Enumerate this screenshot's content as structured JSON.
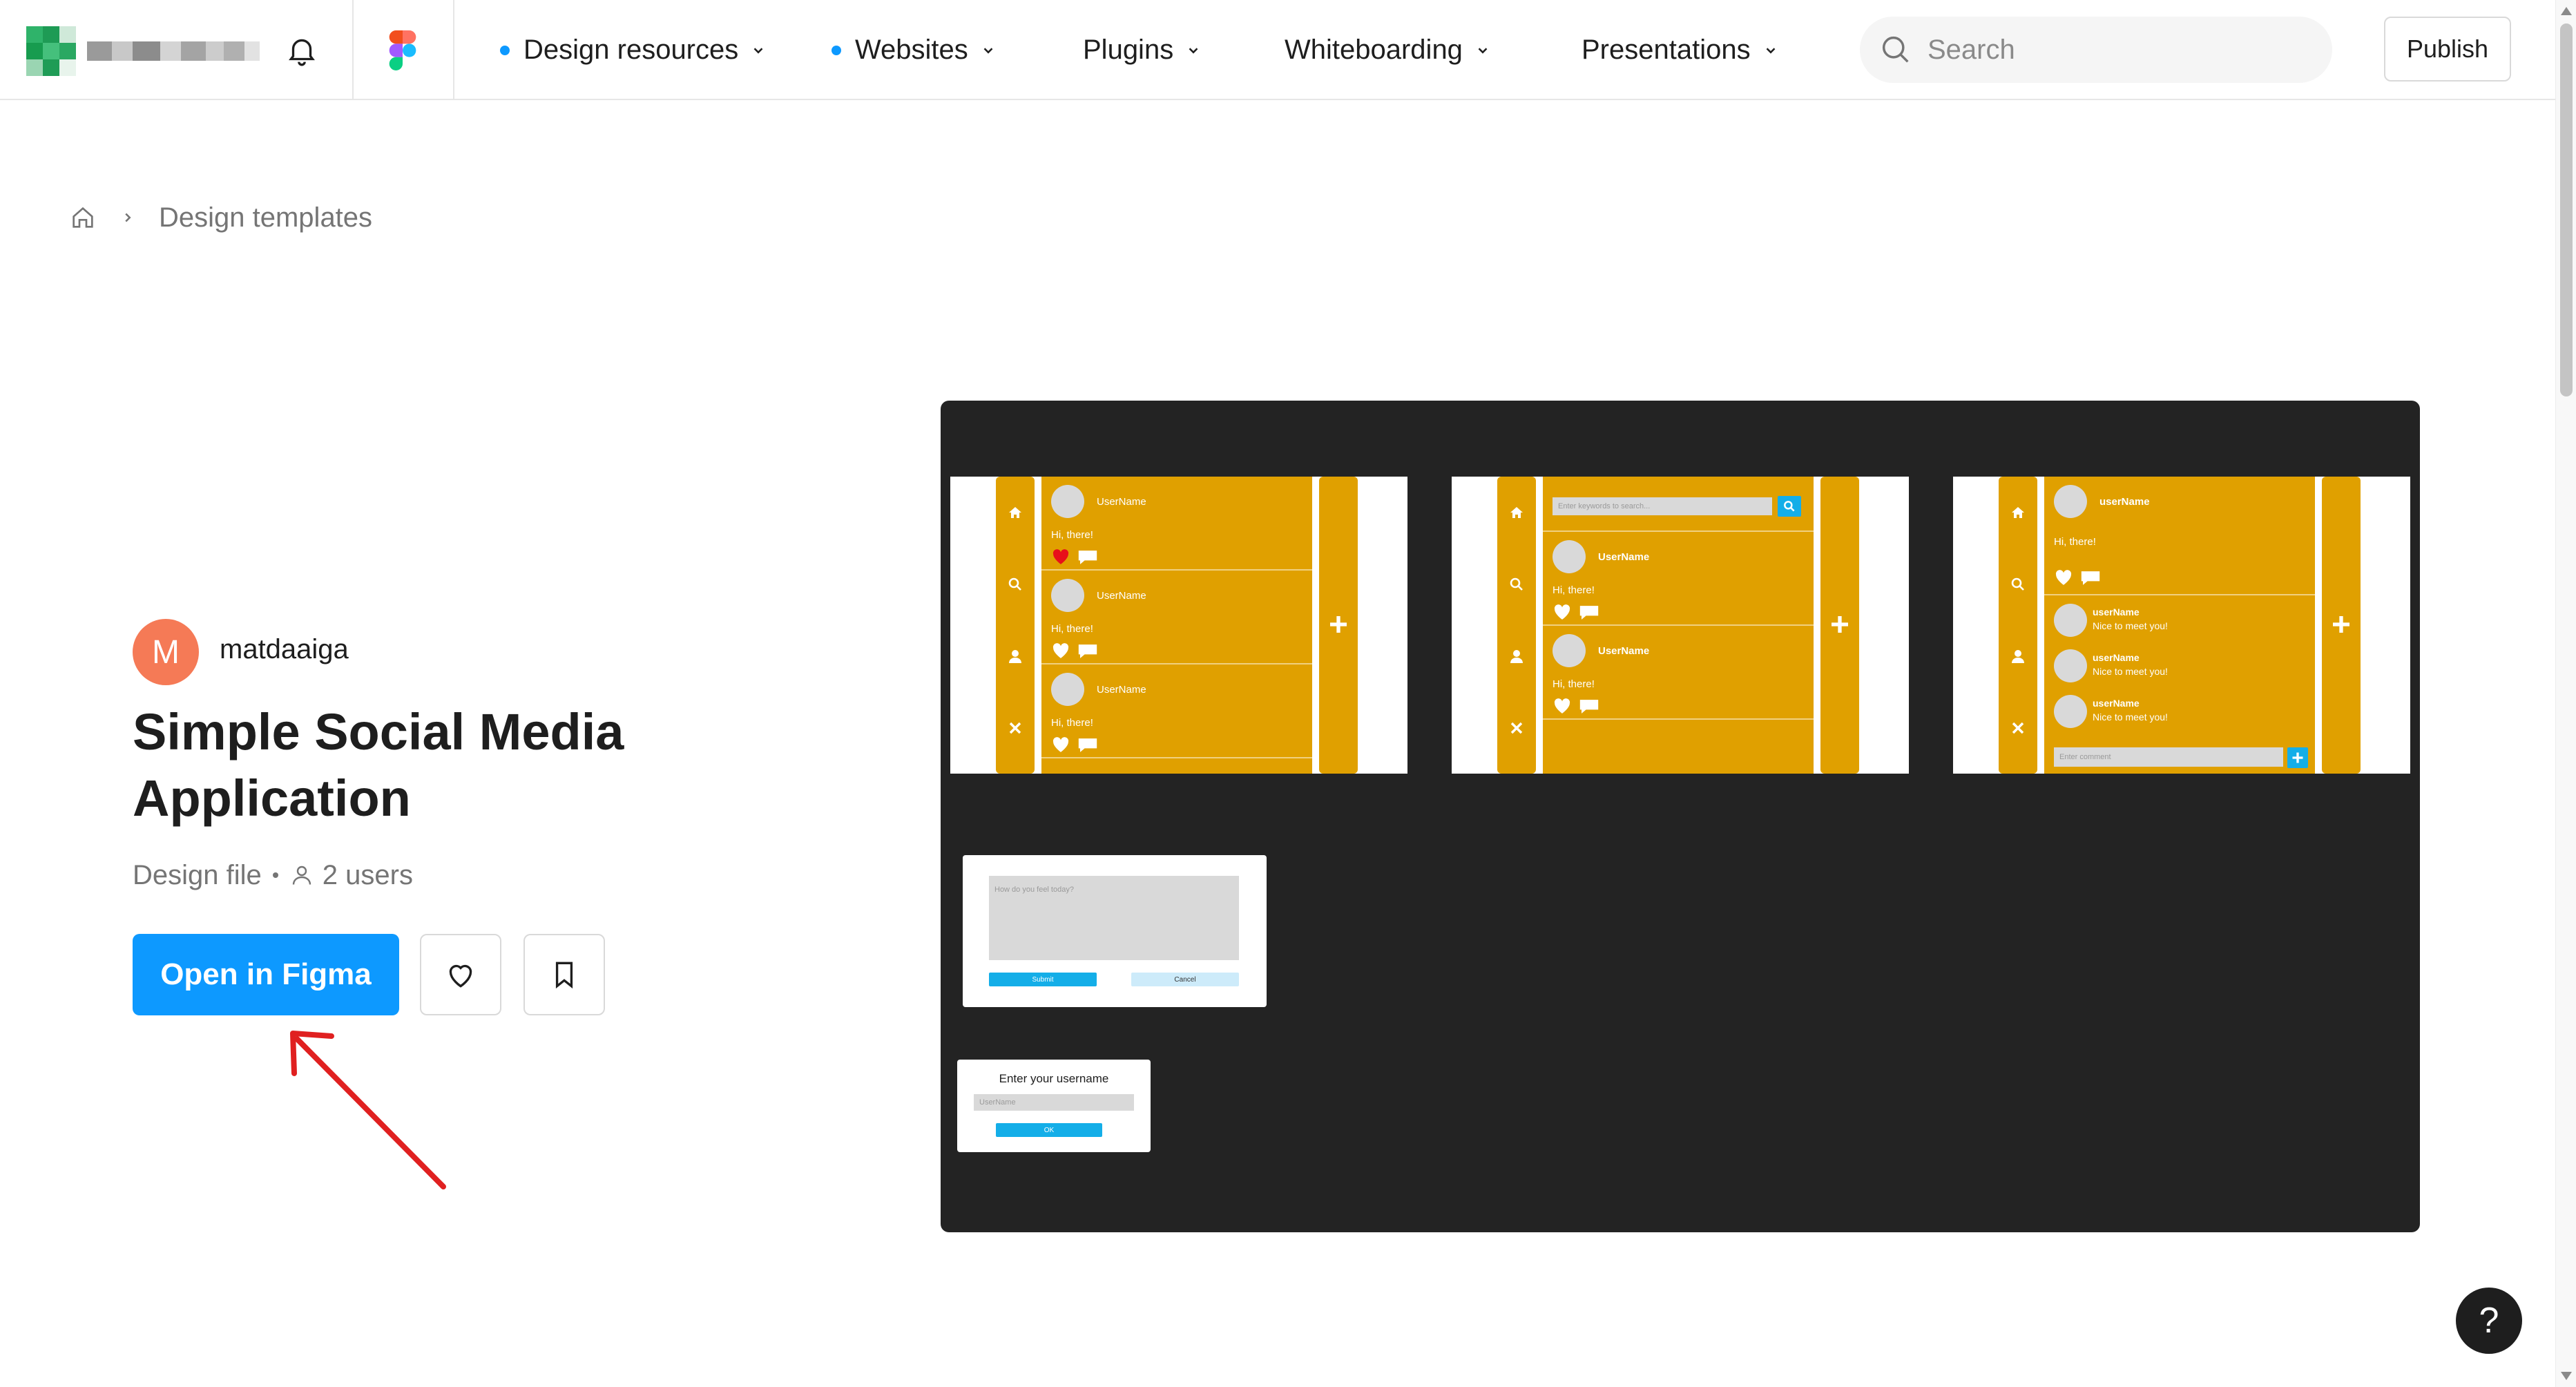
{
  "header": {
    "nav": [
      {
        "label": "Design resources",
        "dot": true
      },
      {
        "label": "Websites",
        "dot": true
      },
      {
        "label": "Plugins",
        "dot": false
      },
      {
        "label": "Whiteboarding",
        "dot": false
      },
      {
        "label": "Presentations",
        "dot": false
      }
    ],
    "search_placeholder": "Search",
    "publish_label": "Publish"
  },
  "breadcrumb": {
    "current": "Design templates"
  },
  "file": {
    "author_initial": "M",
    "author": "matdaaiga",
    "title": "Simple Social Media Application",
    "type": "Design file",
    "users": "2 users",
    "open_label": "Open in Figma"
  },
  "preview": {
    "screen1": {
      "posts": [
        {
          "user": "UserName",
          "text": "Hi, there!",
          "liked": true
        },
        {
          "user": "UserName",
          "text": "Hi, there!",
          "liked": false
        },
        {
          "user": "UserName",
          "text": "Hi, there!",
          "liked": false
        }
      ]
    },
    "screen2": {
      "search_placeholder": "Enter keywords to search...",
      "posts": [
        {
          "user": "UserName",
          "text": "Hi, there!"
        },
        {
          "user": "UserName",
          "text": "Hi, there!"
        }
      ]
    },
    "screen3": {
      "user": "userName",
      "text": "Hi, there!",
      "comments": [
        {
          "user": "userName",
          "text": "Nice to meet you!"
        },
        {
          "user": "userName",
          "text": "Nice to meet you!"
        },
        {
          "user": "userName",
          "text": "Nice to meet you!"
        }
      ],
      "comment_placeholder": "Enter comment"
    },
    "post_dialog": {
      "placeholder": "How do you feel today?",
      "submit": "Submit",
      "cancel": "Cancel"
    },
    "username_dialog": {
      "title": "Enter your username",
      "placeholder": "UserName",
      "ok": "OK"
    }
  },
  "help_label": "?",
  "colors": {
    "accent": "#0d99ff",
    "mockup_yellow": "#e0a000",
    "canvas": "#232323",
    "annotation": "#e02020"
  }
}
